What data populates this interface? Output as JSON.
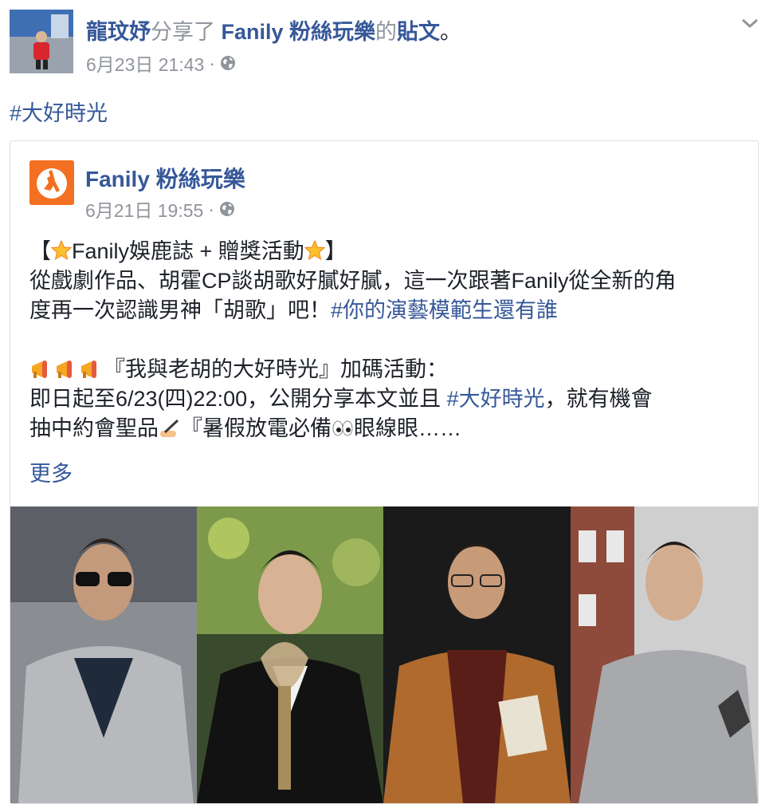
{
  "post": {
    "author": "龍玟妤",
    "shared_text": "分享了",
    "shared_page": "Fanily 粉絲玩樂",
    "shared_suffix": "的",
    "shared_object": "貼文",
    "period": "。",
    "timestamp": "6月23日 21:43",
    "dot": "·",
    "hashtag": "#大好時光"
  },
  "shared_post": {
    "page_name": "Fanily 粉絲玩樂",
    "timestamp": "6月21日 19:55",
    "dot": "·",
    "l1_a": "【",
    "l1_b": "Fanily娛鹿誌 + 贈獎活動",
    "l1_c": "】",
    "l2": "從戲劇作品、胡霍CP談胡歌好膩好膩，這一次跟著Fanily從全新的角",
    "l3_text": "度再一次認識男神「胡歌」吧！",
    "l3_tag": "#你的演藝模範生還有誰",
    "l5_text": "『我與老胡的大好時光』加碼活動：",
    "l6_text": "即日起至6/23(四)22:00，公開分享本文並且 ",
    "l6_tag": "#大好時光",
    "l6_end": "，就有機會",
    "l7_a": "抽中約會聖品",
    "l7_b": "『暑假放電必備",
    "l7_c": "眼線眼……",
    "more": "更多"
  },
  "icons": [
    "globe-icon",
    "chevron-down-icon",
    "star-emoji",
    "megaphone-emoji",
    "writing-hand-emoji",
    "eyes-emoji"
  ],
  "colors": {
    "link": "#365899",
    "muted": "#90949c",
    "text": "#1d2129",
    "brand": "#f36f21"
  }
}
